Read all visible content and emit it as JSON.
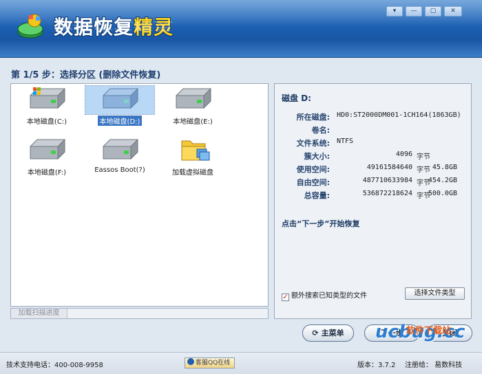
{
  "app": {
    "title_main": "数据恢复",
    "title_accent": "精灵"
  },
  "window_controls": {
    "menu": "▾",
    "minimize": "—",
    "maximize": "▢",
    "close": "✕"
  },
  "step": {
    "title": "第 1/5 步：选择分区 (删除文件恢复)"
  },
  "partitions": [
    {
      "label": "本地磁盘(C:)",
      "icon": "windows-drive-icon",
      "selected": false
    },
    {
      "label": "本地磁盘(D:)",
      "icon": "drive-icon",
      "selected": true
    },
    {
      "label": "本地磁盘(E:)",
      "icon": "drive-icon",
      "selected": false
    },
    {
      "label": "本地磁盘(F:)",
      "icon": "drive-icon",
      "selected": false
    },
    {
      "label": "Eassos Boot(?)",
      "icon": "drive-icon",
      "selected": false
    },
    {
      "label": "加载虚拟磁盘",
      "icon": "folder-icon",
      "selected": false
    }
  ],
  "scan": {
    "label": "加载扫描进度"
  },
  "disk_info": {
    "title": "磁盘 D:",
    "rows": [
      {
        "key": "所在磁盘:",
        "value": "HD0:ST2000DM001-1CH164(1863GB)"
      },
      {
        "key": "卷名:",
        "value": ""
      },
      {
        "key": "文件系统:",
        "value": "NTFS"
      },
      {
        "key": "簇大小:",
        "num": "4096",
        "unit": "字节"
      },
      {
        "key": "使用空间:",
        "num": "49161584640",
        "unit": "字节",
        "size": "45.8GB"
      },
      {
        "key": "自由空间:",
        "num": "487710633984",
        "unit": "字节",
        "size": "454.2GB"
      },
      {
        "key": "总容量:",
        "num": "536872218624",
        "unit": "字节",
        "size": "500.0GB"
      }
    ],
    "next_hint": "点击“下一步”开始恢复",
    "extra_search_label": "额外搜索已知类型的文件",
    "extra_search_checked": true,
    "select_type_button": "选择文件类型"
  },
  "buttons": {
    "main_menu": "主菜单",
    "next": "下一步",
    "close": "关闭"
  },
  "watermark": {
    "brand": "ucbug",
    "brand_suffix": ".cc",
    "sub": "软件下载站"
  },
  "status_bar": {
    "support": "技术支持电话：400-008-9958",
    "qq": "客服QQ在线",
    "version": "版本：3.7.2",
    "registered": "注册给：  易数科技"
  },
  "colors": {
    "header_blue": "#1c60b3",
    "accent_yellow": "#ffd51c",
    "select_blue": "#3a76c3"
  }
}
